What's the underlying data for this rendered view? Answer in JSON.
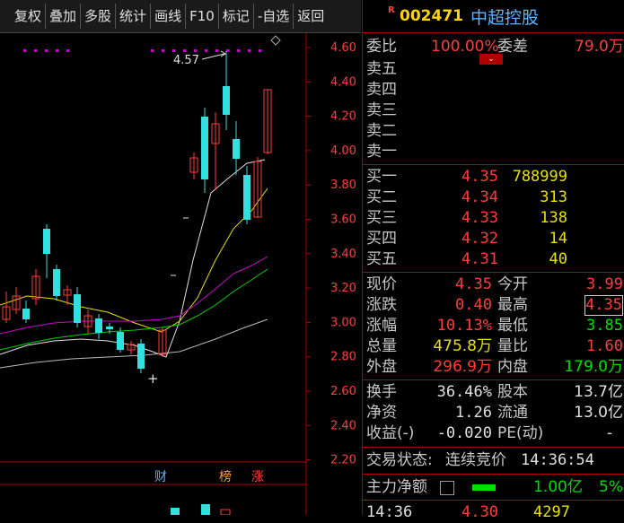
{
  "toolbar": {
    "items": [
      "复权",
      "叠加",
      "多股",
      "统计",
      "画线",
      "F10",
      "标记",
      "-自选",
      "返回"
    ]
  },
  "chart": {
    "price_axis": [
      "4.60",
      "4.40",
      "4.20",
      "4.00",
      "3.80",
      "3.60",
      "3.40",
      "3.20",
      "3.00",
      "2.80",
      "2.60",
      "2.40",
      "2.20"
    ],
    "high_label": "4.57",
    "low_marker": "+",
    "event_tags": [
      {
        "text": "财",
        "color": "#5ab4ff"
      },
      {
        "text": "榜",
        "color": "#ff9d3c"
      },
      {
        "text": "涨",
        "color": "#ff3c3c"
      }
    ]
  },
  "header": {
    "badge": "R",
    "code": "002471",
    "name": "中超控股"
  },
  "order_book": {
    "weibi_label": "委比",
    "weibi_value": "100.00%",
    "weicha_label": "委差",
    "weicha_value": "79.0万",
    "sells": [
      {
        "label": "卖五"
      },
      {
        "label": "卖四"
      },
      {
        "label": "卖三"
      },
      {
        "label": "卖二"
      },
      {
        "label": "卖一"
      }
    ],
    "buys": [
      {
        "label": "买一",
        "price": "4.35",
        "vol": "788999"
      },
      {
        "label": "买二",
        "price": "4.34",
        "vol": "313"
      },
      {
        "label": "买三",
        "price": "4.33",
        "vol": "138"
      },
      {
        "label": "买四",
        "price": "4.32",
        "vol": "14"
      },
      {
        "label": "买五",
        "price": "4.31",
        "vol": "40"
      }
    ]
  },
  "quote": {
    "xianjia_label": "现价",
    "xianjia": "4.35",
    "jinkai_label": "今开",
    "jinkai": "3.99",
    "zhangdie_label": "涨跌",
    "zhangdie": "0.40",
    "zuigao_label": "最高",
    "zuigao": "4.35",
    "zhangfu_label": "涨幅",
    "zhangfu": "10.13%",
    "zuidi_label": "最低",
    "zuidi": "3.85",
    "zongliang_label": "总量",
    "zongliang": "475.8万",
    "liangbi_label": "量比",
    "liangbi": "1.60",
    "waipan_label": "外盘",
    "waipan": "296.9万",
    "neipan_label": "内盘",
    "neipan": "179.0万"
  },
  "fundamentals": {
    "huanshou_label": "换手",
    "huanshou": "36.46%",
    "guben_label": "股本",
    "guben": "13.7亿",
    "jingzi_label": "净资",
    "jingzi": "1.26",
    "liutong_label": "流通",
    "liutong": "13.0亿",
    "shouyi_label": "收益(-)",
    "shouyi": "-0.020",
    "pe_label": "PE(动)",
    "pe": "-"
  },
  "status": {
    "label": "交易状态:",
    "value": "连续竞价",
    "time": "14:36:54"
  },
  "net_flow": {
    "label": "主力净额",
    "value": "1.00亿",
    "pct": "5%"
  },
  "last_trade": {
    "time": "14:36",
    "price": "4.30",
    "vol": "4297"
  }
}
